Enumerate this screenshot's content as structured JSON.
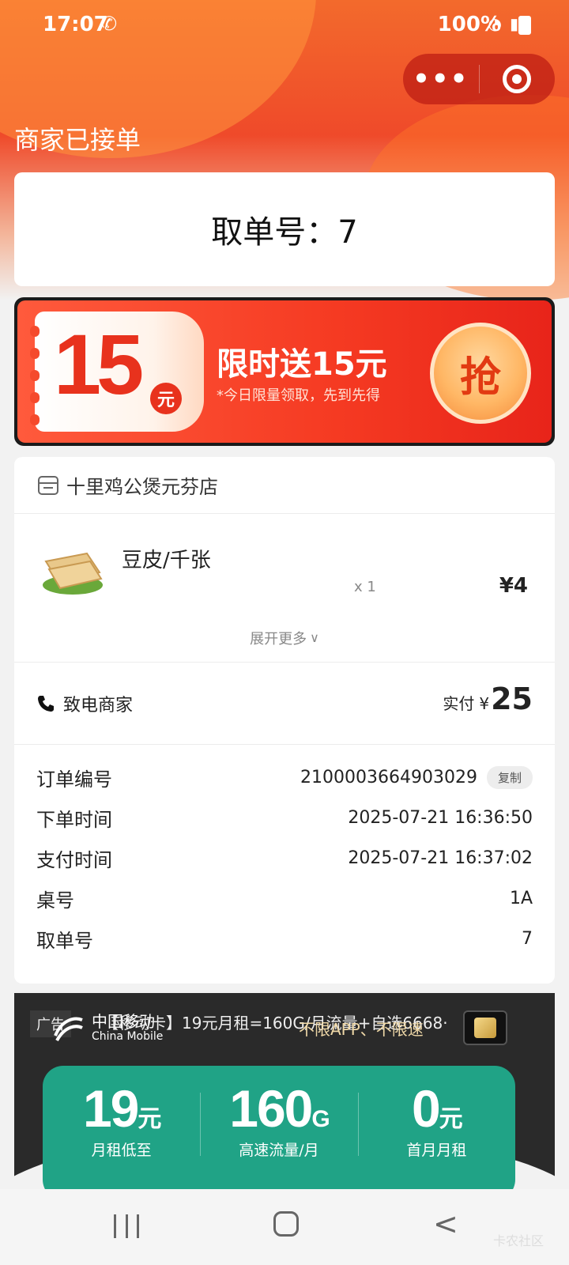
{
  "status_bar": {
    "time": "17:07",
    "battery": "100%"
  },
  "capsule": {
    "more": "•••"
  },
  "order_status": "商家已接单",
  "pickup": {
    "label": "取单号：7"
  },
  "coupon": {
    "amount": "15",
    "unit": "元",
    "title": "限时送15元",
    "subtitle": "*今日限量领取，先到先得",
    "button": "抢"
  },
  "shop": {
    "name": "十里鸡公煲元芬店"
  },
  "items": [
    {
      "name": "豆皮/千张",
      "qty": "x 1",
      "price": "¥4"
    }
  ],
  "expand": {
    "label": "展开更多"
  },
  "payment": {
    "call_label": "致电商家",
    "paid_label": "实付",
    "currency": "¥",
    "amount": "25"
  },
  "details": [
    {
      "label": "订单编号",
      "value": "2100003664903029",
      "action": "复制"
    },
    {
      "label": "下单时间",
      "value": "2025-07-21 16:36:50"
    },
    {
      "label": "支付时间",
      "value": "2025-07-21 16:37:02"
    },
    {
      "label": "桌号",
      "value": "1A"
    },
    {
      "label": "取单号",
      "value": "7"
    }
  ],
  "ad": {
    "tag": "广告",
    "brand_cn": "中国移动",
    "brand_en": "China Mobile",
    "headline": "【移动卡】19元月租=160G/月流量+自选6668·",
    "slogan": "不限APP、不限速",
    "stats": [
      {
        "value": "19",
        "unit": "元",
        "caption": "月租低至"
      },
      {
        "value": "160",
        "unit": "G",
        "caption": "高速流量/月"
      },
      {
        "value": "0",
        "unit": "元",
        "caption": "首月月租"
      }
    ]
  },
  "watermark": "卡农社区",
  "colors": {
    "header": "#ef4a2a",
    "coupon_red": "#e8321d",
    "ad_green": "#20a386"
  }
}
